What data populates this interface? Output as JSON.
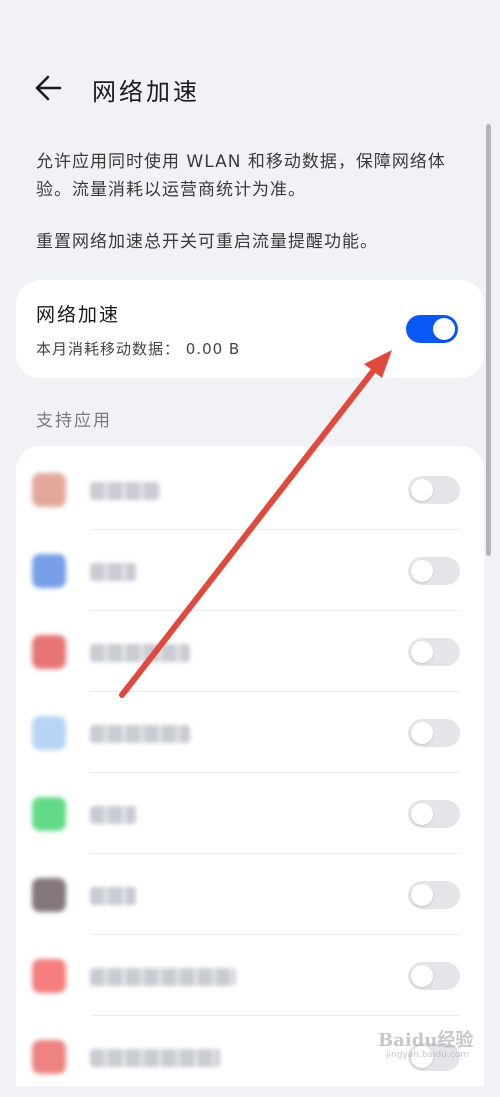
{
  "header": {
    "title": "网络加速",
    "back_icon": "arrow-left-icon"
  },
  "description": {
    "line1": "允许应用同时使用 WLAN 和移动数据，保障网络体验。流量消耗以运营商统计为准。",
    "line2": "重置网络加速总开关可重启流量提醒功能。"
  },
  "network_acceleration": {
    "title": "网络加速",
    "usage": "本月消耗移动数据： 0.00 B",
    "enabled": true
  },
  "supported_apps": {
    "section_title": "支持应用",
    "apps": [
      {
        "icon_color": "#d98c7a",
        "enabled": false
      },
      {
        "icon_color": "#4a7fe0",
        "enabled": false
      },
      {
        "icon_color": "#e04848",
        "enabled": false
      },
      {
        "icon_color": "#9fc6f2",
        "enabled": false
      },
      {
        "icon_color": "#2ecf60",
        "enabled": false
      },
      {
        "icon_color": "#5a4a50",
        "enabled": false
      },
      {
        "icon_color": "#f25555",
        "enabled": false
      },
      {
        "icon_color": "#e85a5a",
        "enabled": false
      }
    ]
  },
  "colors": {
    "accent": "#0a59f7",
    "annotation_arrow": "#e04a3c",
    "background": "#f1f2f6"
  },
  "watermark": {
    "text": "Baidu经验",
    "url": "jingyan.baidu.com"
  }
}
